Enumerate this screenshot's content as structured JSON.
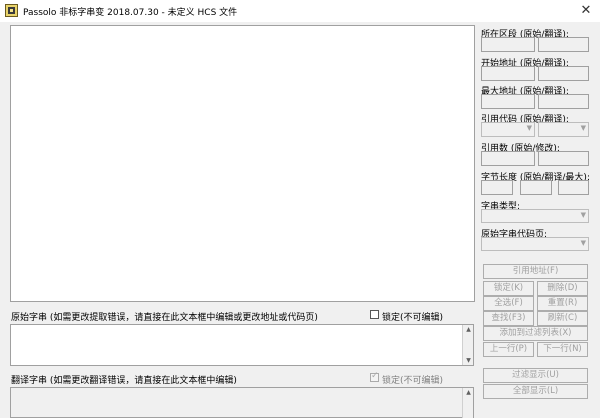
{
  "window": {
    "title": "Passolo 非标字串变 2018.07.30 - 未定义 HCS 文件",
    "icon": "app-icon",
    "close_glyph": "✕"
  },
  "right_panel": {
    "fields": [
      {
        "label": "所在区段 (原始/翻译):"
      },
      {
        "label": "开始地址 (原始/翻译):"
      },
      {
        "label": "最大地址 (原始/翻译):"
      }
    ],
    "ref_code_label": "引用代码 (原始/翻译):",
    "ref_count_label": "引用数 (原始/修改):",
    "byte_length_label": "字节长度 (原始/翻译/最大):",
    "string_type_label": "字串类型:",
    "orig_codepage_label": "原始字串代码页:"
  },
  "buttons": {
    "ref_addr": "引用地址(F)",
    "lock": "锁定(K)",
    "delete": "删除(D)",
    "select_all": "全选(F)",
    "reset": "重置(R)",
    "find": "查找(F3)",
    "refresh": "刷新(C)",
    "add_filter": "添加到过滤列表(X)",
    "prev": "上一行(P)",
    "next": "下一行(N)",
    "filter_show": "过滤显示(U)",
    "show_all": "全部显示(L)"
  },
  "source": {
    "label": "原始字串 (如需更改提取错误，请直接在此文本框中编辑或更改地址或代码页)",
    "lock_label": "锁定(不可编辑)",
    "locked": false
  },
  "translation": {
    "label": "翻译字串 (如需更改翻译错误，请直接在此文本框中编辑)",
    "lock_label": "锁定(不可编辑)",
    "locked": true
  }
}
